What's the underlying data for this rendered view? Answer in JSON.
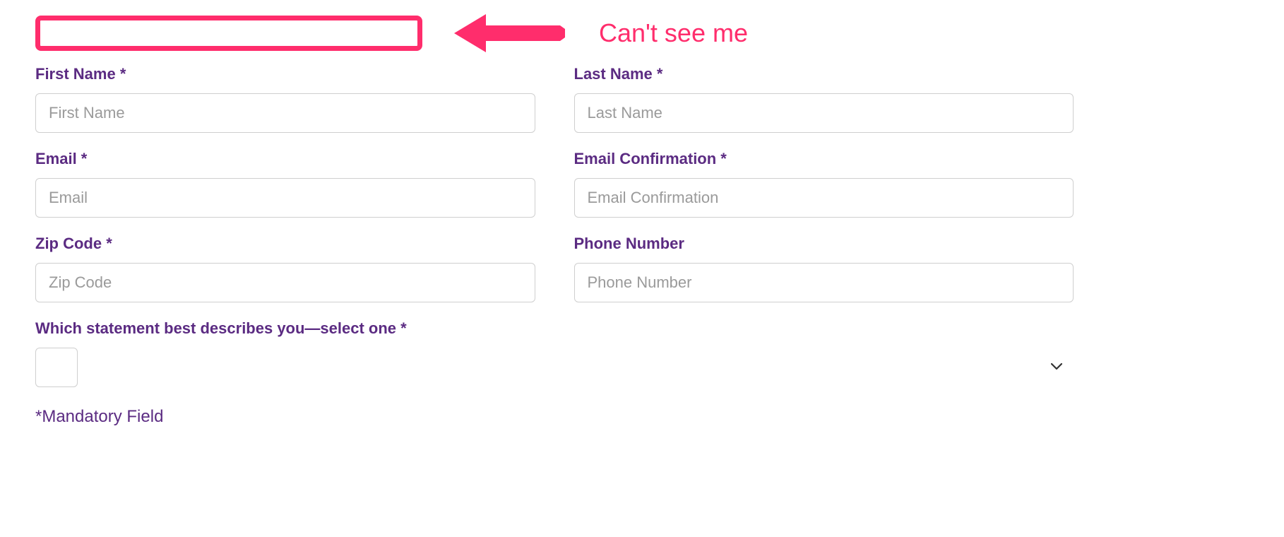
{
  "annotation": {
    "text": "Can't see me"
  },
  "form": {
    "first_name": {
      "label": "First Name *",
      "placeholder": "First Name",
      "value": ""
    },
    "last_name": {
      "label": "Last Name *",
      "placeholder": "Last Name",
      "value": ""
    },
    "email": {
      "label": "Email *",
      "placeholder": "Email",
      "value": ""
    },
    "email_confirm": {
      "label": "Email Confirmation *",
      "placeholder": "Email Confirmation",
      "value": ""
    },
    "zip_code": {
      "label": "Zip Code *",
      "placeholder": "Zip Code",
      "value": ""
    },
    "phone": {
      "label": "Phone Number",
      "placeholder": "Phone Number",
      "value": ""
    },
    "statement": {
      "label": "Which statement best describes you—select one *",
      "value": ""
    },
    "mandatory_note": "*Mandatory Field"
  },
  "colors": {
    "accent_pink": "#ff2d6c",
    "label_purple": "#5b2b82"
  }
}
